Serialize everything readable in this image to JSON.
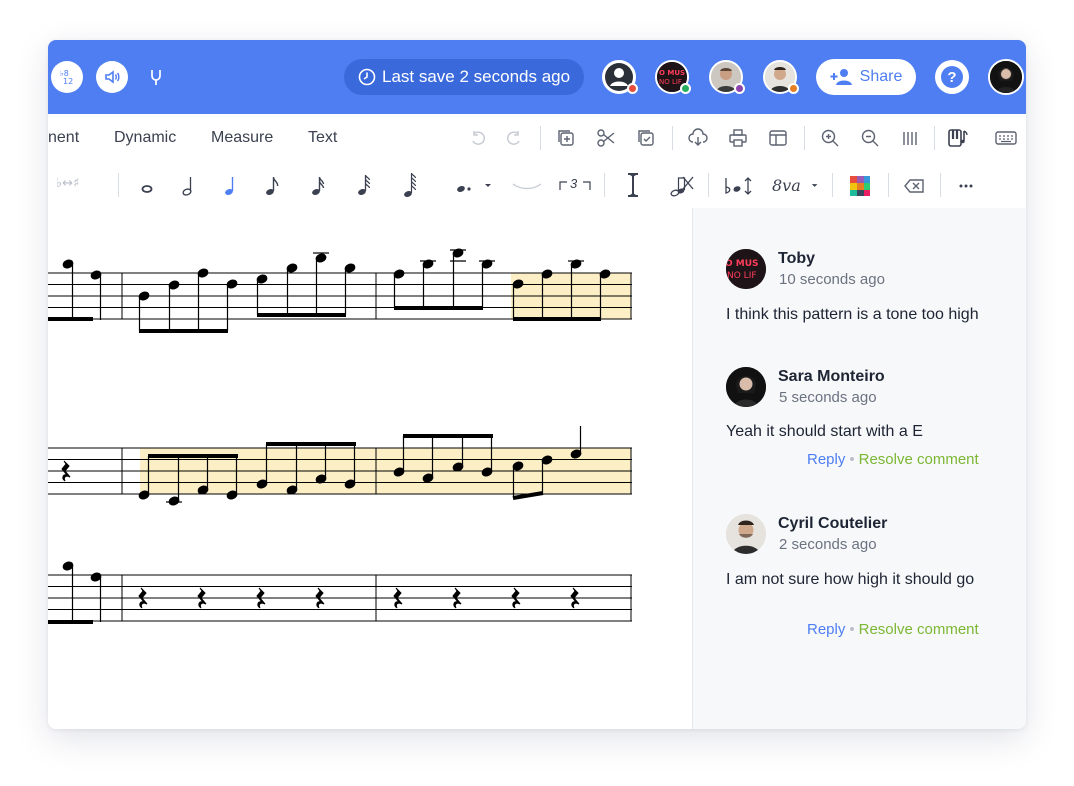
{
  "topbar": {
    "save_status": "Last save 2 seconds ago",
    "share_label": "Share",
    "help_label": "?",
    "presence_colors": [
      "#e74c3c",
      "#27ae60",
      "#8e44ad",
      "#e67e22"
    ],
    "avatar_text": "O MUS\nNO LIF"
  },
  "menu": {
    "items": [
      "nent",
      "Dynamic",
      "Measure",
      "Text"
    ]
  },
  "notebar": {
    "accidental_label": "♭↔♯",
    "tuplet_label": "3",
    "ottava_label": "8va"
  },
  "comments": [
    {
      "author": "Toby",
      "time": "10 seconds ago",
      "text": "I think this pattern is a tone too high",
      "avatar": "toby"
    },
    {
      "author": "Sara Monteiro",
      "time": "5 seconds ago",
      "text": "Yeah it should start with a E",
      "reply": "Reply",
      "resolve": "Resolve comment",
      "avatar": "sara"
    },
    {
      "author": "Cyril Coutelier",
      "time": "2 seconds ago",
      "text": "I am not sure how high it should go",
      "reply": "Reply",
      "resolve": "Resolve comment",
      "avatar": "cyril"
    }
  ],
  "colors": {
    "brand": "#4e7ef2",
    "highlight": "#fcefc6",
    "resolve": "#7cb733"
  }
}
